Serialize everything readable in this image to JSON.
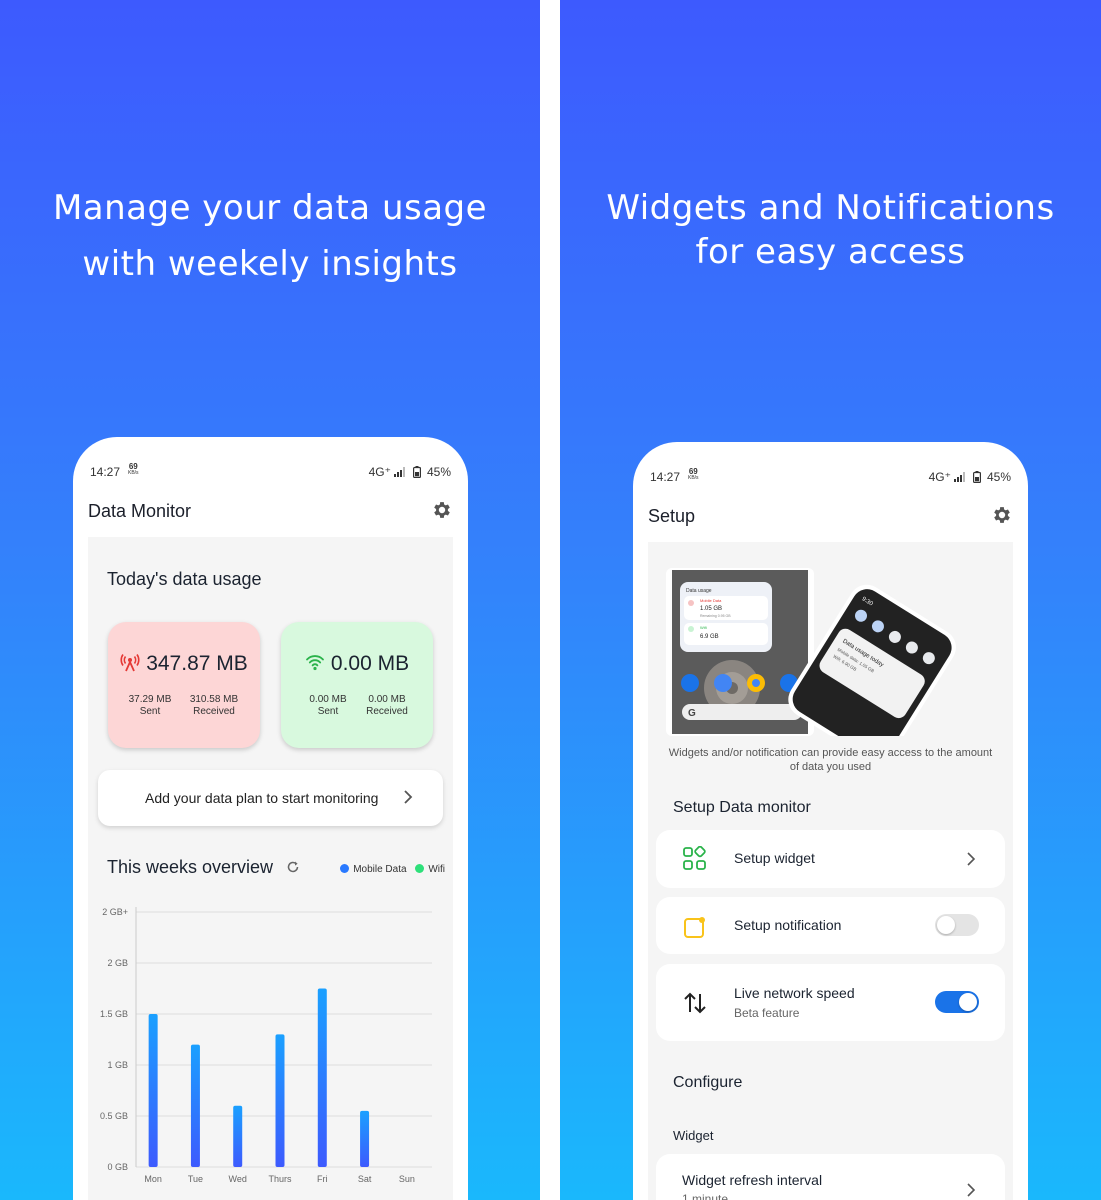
{
  "left_panel": {
    "headline": [
      "Manage your data usage",
      "with weekely insights"
    ],
    "status": {
      "time": "14:27",
      "speed": "69",
      "speed_unit": "KB/s",
      "network": "4G⁺",
      "battery": "45%"
    },
    "app_title": "Data Monitor",
    "today_title": "Today's data usage",
    "mobile_card": {
      "total": "347.87 MB",
      "sent_value": "37.29 MB",
      "sent_label": "Sent",
      "received_value": "310.58 MB",
      "received_label": "Received",
      "color": "#fdd6d6",
      "icon": "cell-tower-icon"
    },
    "wifi_card": {
      "total": "0.00 MB",
      "sent_value": "0.00 MB",
      "sent_label": "Sent",
      "received_value": "0.00 MB",
      "received_label": "Received",
      "color": "#d8f9de",
      "icon": "wifi-icon"
    },
    "plan_prompt": "Add your data plan to start monitoring",
    "week_title": "This weeks overview",
    "legend": [
      {
        "label": "Mobile Data",
        "color": "#2979ff"
      },
      {
        "label": "Wifi",
        "color": "#2ee07a"
      }
    ]
  },
  "chart_data": {
    "type": "bar",
    "categories": [
      "Mon",
      "Tue",
      "Wed",
      "Thurs",
      "Fri",
      "Sat",
      "Sun"
    ],
    "series": [
      {
        "name": "Mobile Data",
        "values": [
          1.5,
          1.2,
          0.6,
          1.3,
          1.75,
          0.55,
          0
        ]
      }
    ],
    "ytick_labels": [
      "0 GB",
      "0.5 GB",
      "1 GB",
      "1.5 GB",
      "2 GB",
      "2 GB+"
    ],
    "ylim": [
      0,
      2.5
    ],
    "grid": true
  },
  "right_panel": {
    "headline": [
      "Widgets and Notifications",
      "for easy access"
    ],
    "status": {
      "time": "14:27",
      "speed": "69",
      "speed_unit": "KB/s",
      "network": "4G⁺",
      "battery": "45%"
    },
    "app_title": "Setup",
    "widget_preview": {
      "title": "Data usage",
      "mobile_label": "Mobile Data",
      "mobile_value": "1.05 GB",
      "remaining": "Remaining 0.95 GB",
      "wifi_label": "Wifi",
      "wifi_value": "6.9 GB"
    },
    "notification_preview": {
      "time": "9:30",
      "title": "Data usage today",
      "line1": "Mobile data: 1.05 GB",
      "line2": "Wifi: 6.90 GB"
    },
    "caption": "Widgets and/or notification can provide easy access to the amount of data you used",
    "setup_title": "Setup Data monitor",
    "setup_widget": "Setup widget",
    "setup_notification": "Setup notification",
    "notification_enabled": false,
    "live_speed": "Live network speed",
    "live_speed_sub": "Beta feature",
    "live_speed_enabled": true,
    "configure_title": "Configure",
    "widget_section": "Widget",
    "refresh_label": "Widget refresh interval",
    "refresh_value": "1 minute",
    "accent": "#1a73e8"
  }
}
